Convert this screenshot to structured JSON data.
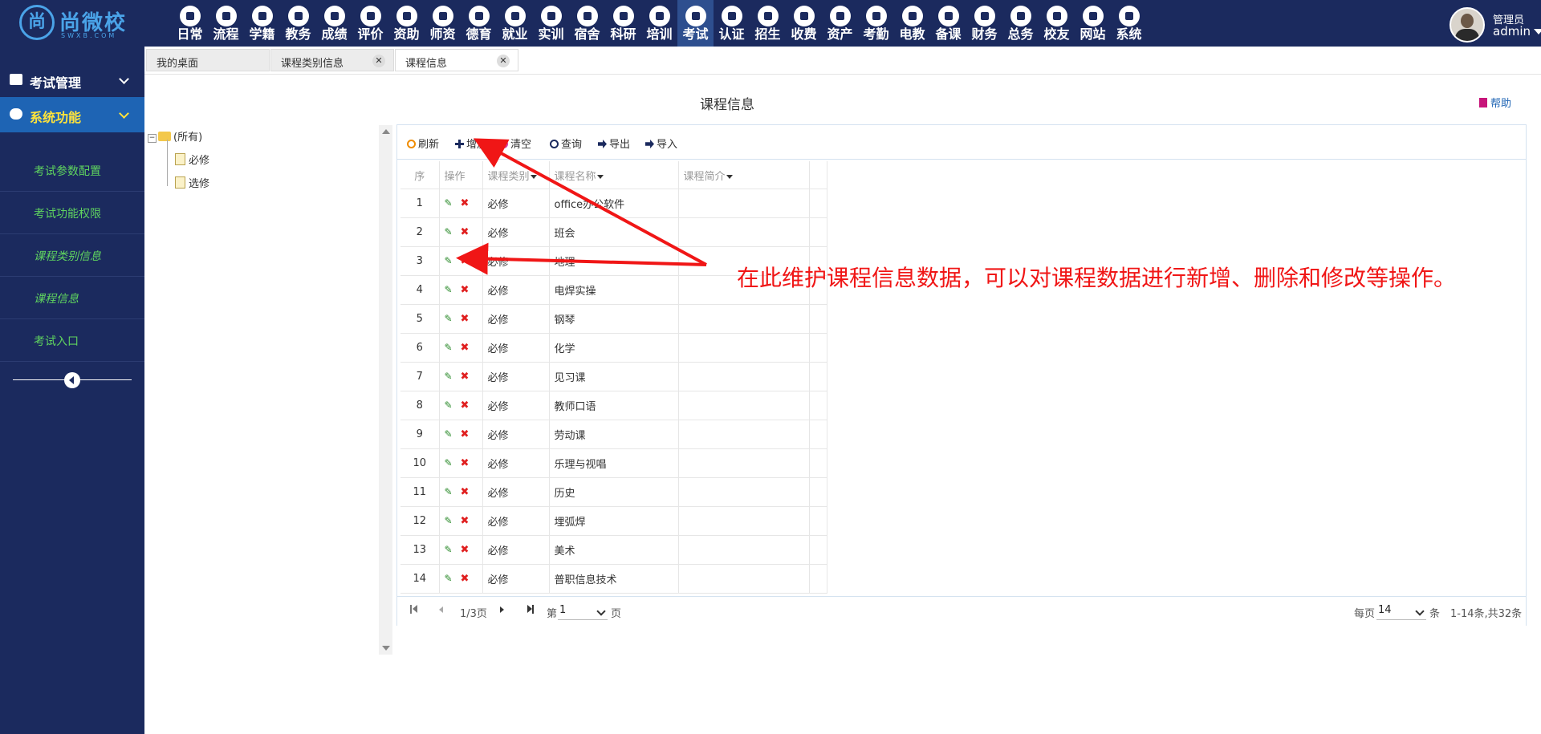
{
  "app": {
    "logo_text": "尚微校",
    "logo_sub": "SWXB.COM",
    "logo_mark": "尚"
  },
  "nav": [
    {
      "label": "日常",
      "icon": "document-icon"
    },
    {
      "label": "流程",
      "icon": "flow-icon"
    },
    {
      "label": "学籍",
      "icon": "student-icon"
    },
    {
      "label": "教务",
      "icon": "calendar-icon"
    },
    {
      "label": "成绩",
      "icon": "chart-line-icon"
    },
    {
      "label": "评价",
      "icon": "calendar-plus-icon"
    },
    {
      "label": "资助",
      "icon": "user-help-icon"
    },
    {
      "label": "师资",
      "icon": "teacher-icon"
    },
    {
      "label": "德育",
      "icon": "book-icon"
    },
    {
      "label": "就业",
      "icon": "hammer-icon"
    },
    {
      "label": "实训",
      "icon": "robot-icon"
    },
    {
      "label": "宿舍",
      "icon": "home-icon"
    },
    {
      "label": "科研",
      "icon": "graduation-cap-icon"
    },
    {
      "label": "培训",
      "icon": "image-icon"
    },
    {
      "label": "考试",
      "icon": "key-icon",
      "active": true
    },
    {
      "label": "认证",
      "icon": "monitor-icon"
    },
    {
      "label": "招生",
      "icon": "bus-icon"
    },
    {
      "label": "收费",
      "icon": "yen-icon"
    },
    {
      "label": "资产",
      "icon": "train-icon"
    },
    {
      "label": "考勤",
      "icon": "t-badge-icon"
    },
    {
      "label": "电教",
      "icon": "video-icon"
    },
    {
      "label": "备课",
      "icon": "edit-icon"
    },
    {
      "label": "财务",
      "icon": "newspaper-icon"
    },
    {
      "label": "总务",
      "icon": "bar-chart-icon"
    },
    {
      "label": "校友",
      "icon": "users-icon"
    },
    {
      "label": "网站",
      "icon": "cloud-icon"
    },
    {
      "label": "系统",
      "icon": "cube-icon"
    }
  ],
  "user": {
    "role": "管理员",
    "name": "admin"
  },
  "sidebar": {
    "groups": [
      {
        "label": "考试管理",
        "icon": "book-icon"
      },
      {
        "label": "系统功能",
        "icon": "cloud-icon"
      }
    ],
    "items": [
      {
        "label": "考试参数配置"
      },
      {
        "label": "考试功能权限"
      },
      {
        "label": "课程类别信息"
      },
      {
        "label": "课程信息"
      },
      {
        "label": "考试入口"
      }
    ]
  },
  "tabs": [
    {
      "label": "我的桌面"
    },
    {
      "label": "课程类别信息",
      "close": "✕"
    },
    {
      "label": "课程信息",
      "close": "✕"
    }
  ],
  "page": {
    "title": "课程信息",
    "help": "帮助"
  },
  "tree": {
    "root": "(所有)",
    "children": [
      "必修",
      "选修"
    ]
  },
  "toolbar": {
    "refresh": "刷新",
    "add": "增加",
    "clear": "清空",
    "search": "查询",
    "export": "导出",
    "import": "导入"
  },
  "table": {
    "headers": [
      "序",
      "操作",
      "课程类别",
      "课程名称",
      "课程简介"
    ],
    "rows": [
      {
        "no": "1",
        "category": "必修",
        "name": "office办公软件",
        "intro": ""
      },
      {
        "no": "2",
        "category": "必修",
        "name": "班会",
        "intro": ""
      },
      {
        "no": "3",
        "category": "必修",
        "name": "地理",
        "intro": ""
      },
      {
        "no": "4",
        "category": "必修",
        "name": "电焊实操",
        "intro": ""
      },
      {
        "no": "5",
        "category": "必修",
        "name": "钢琴",
        "intro": ""
      },
      {
        "no": "6",
        "category": "必修",
        "name": "化学",
        "intro": ""
      },
      {
        "no": "7",
        "category": "必修",
        "name": "见习课",
        "intro": ""
      },
      {
        "no": "8",
        "category": "必修",
        "name": "教师口语",
        "intro": ""
      },
      {
        "no": "9",
        "category": "必修",
        "name": "劳动课",
        "intro": ""
      },
      {
        "no": "10",
        "category": "必修",
        "name": "乐理与视唱",
        "intro": ""
      },
      {
        "no": "11",
        "category": "必修",
        "name": "历史",
        "intro": ""
      },
      {
        "no": "12",
        "category": "必修",
        "name": "埋弧焊",
        "intro": ""
      },
      {
        "no": "13",
        "category": "必修",
        "name": "美术",
        "intro": ""
      },
      {
        "no": "14",
        "category": "必修",
        "name": "普职信息技术",
        "intro": ""
      }
    ]
  },
  "pager": {
    "page_info": "1/3页",
    "goto_prefix": "第",
    "goto_value": "1",
    "goto_suffix": "页",
    "per_page_prefix": "每页",
    "per_page_value": "14",
    "per_page_suffix": "条",
    "range": "1-14条,共32条"
  },
  "annotation": {
    "text": "在此维护课程信息数据，可以对课程数据进行新增、删除和修改等操作。",
    "color": "#f01616"
  },
  "colors": {
    "nav_bg": "#1b2a5e",
    "sidebar_active": "#1e64b4",
    "sidebar_item_text": "#5fd35f",
    "accent_yellow": "#ffe33b"
  }
}
